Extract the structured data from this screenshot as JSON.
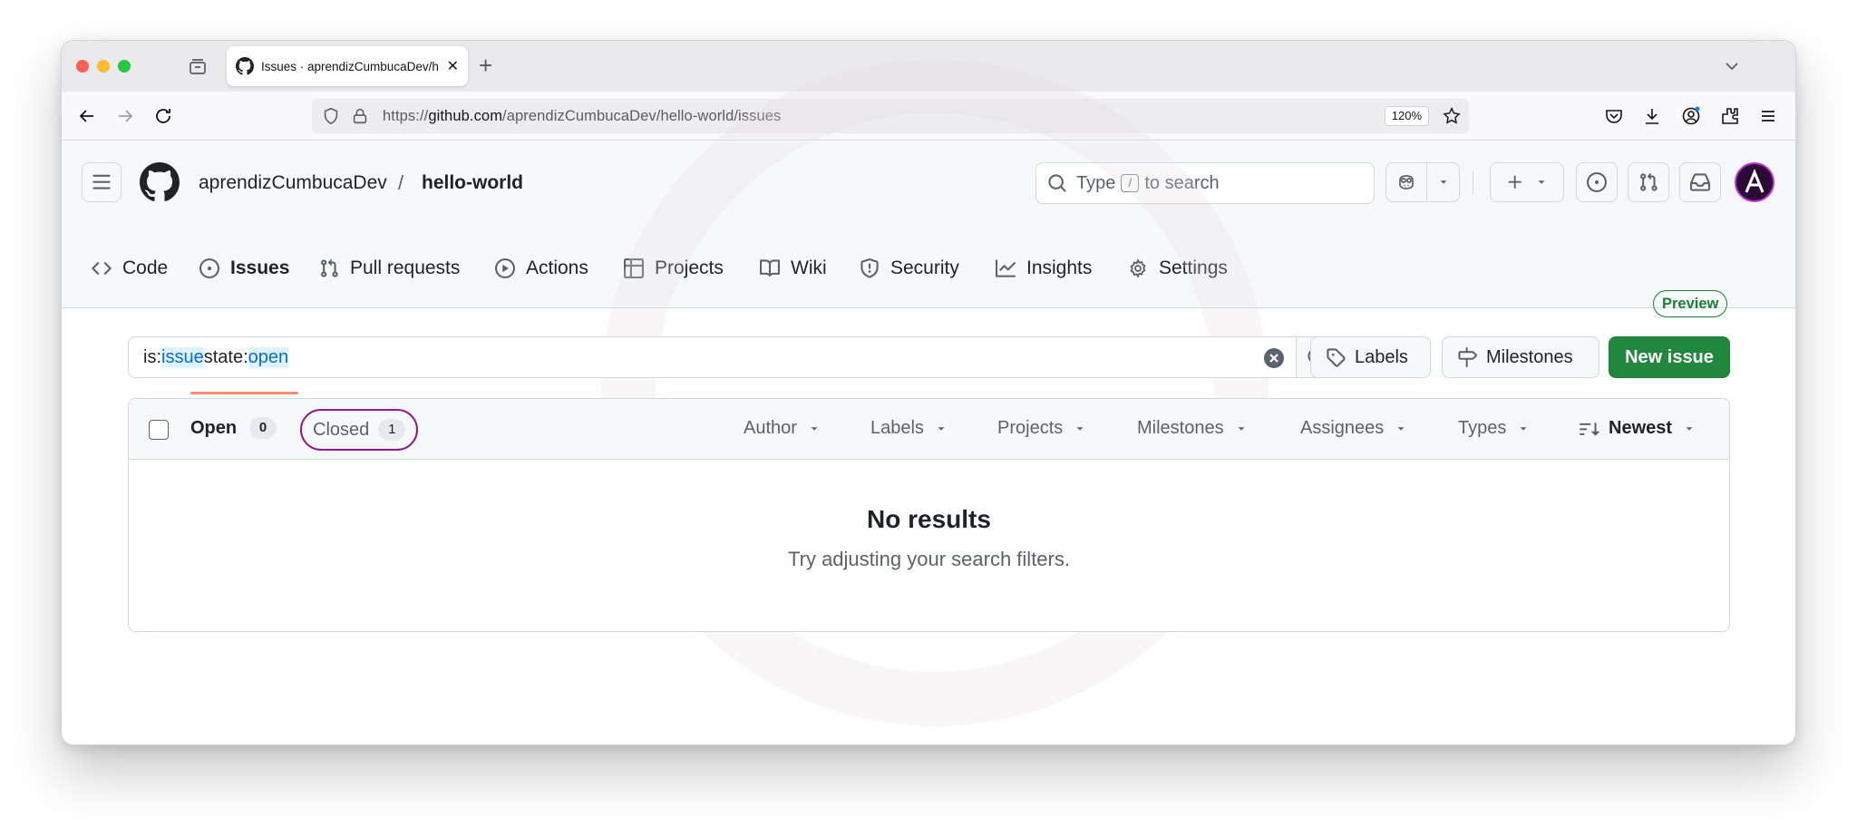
{
  "browser": {
    "tab_title": "Issues · aprendizCumbucaDev/h",
    "url_prefix": "https://",
    "url_host": "github.com",
    "url_path": "/aprendizCumbucaDev/hello-world/issues",
    "zoom": "120%",
    "new_tab": "+",
    "tab_close": "✕"
  },
  "header": {
    "owner": "aprendizCumbucaDev",
    "separator": "/",
    "repo": "hello-world",
    "search_prefix": "Type",
    "search_key": "/",
    "search_suffix": "to search"
  },
  "repo_tabs": [
    {
      "label": "Code",
      "icon": "code-icon"
    },
    {
      "label": "Issues",
      "icon": "issue-opened-icon",
      "active": true
    },
    {
      "label": "Pull requests",
      "icon": "git-pull-request-icon"
    },
    {
      "label": "Actions",
      "icon": "play-icon"
    },
    {
      "label": "Projects",
      "icon": "table-icon"
    },
    {
      "label": "Wiki",
      "icon": "book-icon"
    },
    {
      "label": "Security",
      "icon": "shield-icon"
    },
    {
      "label": "Insights",
      "icon": "graph-icon"
    },
    {
      "label": "Settings",
      "icon": "gear-icon"
    }
  ],
  "content": {
    "preview_badge": "Preview",
    "filter": {
      "k1": "is:",
      "v1": "issue",
      "k2": " state:",
      "v2": "open"
    },
    "labels_button": "Labels",
    "milestones_button": "Milestones",
    "new_issue_button": "New issue"
  },
  "issues_list": {
    "open_label": "Open",
    "open_count": "0",
    "closed_label": "Closed",
    "closed_count": "1",
    "filters": [
      "Author",
      "Labels",
      "Projects",
      "Milestones",
      "Assignees",
      "Types"
    ],
    "sort": "Newest",
    "empty_title": "No results",
    "empty_subtitle": "Try adjusting your search filters."
  },
  "colors": {
    "primary_button": "#1f883d",
    "active_tab_underline": "#fd8c73",
    "closed_highlight": "#8b1a8e",
    "query_highlight": "#0969da"
  }
}
